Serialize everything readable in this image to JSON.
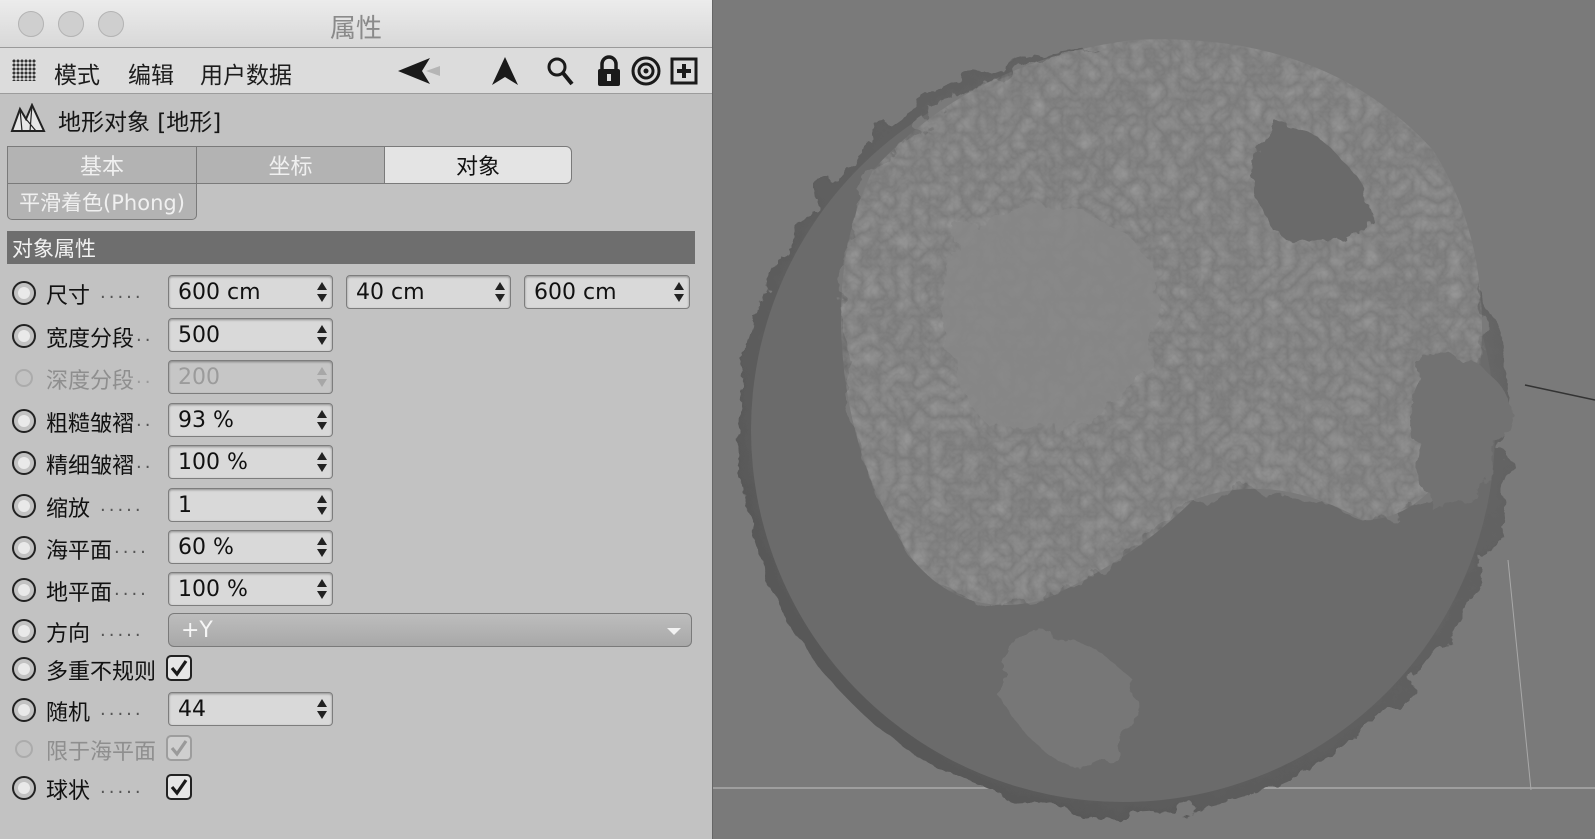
{
  "window": {
    "title": "属性"
  },
  "menu": {
    "items": [
      "模式",
      "编辑",
      "用户数据"
    ]
  },
  "toolbar": {
    "icons": [
      "back-arrow-icon",
      "up-arrow-icon",
      "search-icon",
      "lock-icon",
      "target-icon",
      "add-icon"
    ]
  },
  "object": {
    "title": "地形对象 [地形]",
    "icon": "terrain-icon"
  },
  "tabs": [
    {
      "label": "基本",
      "active": false
    },
    {
      "label": "坐标",
      "active": false
    },
    {
      "label": "对象",
      "active": true
    }
  ],
  "subtab": {
    "label": "平滑着色(Phong)"
  },
  "section": {
    "title": "对象属性"
  },
  "properties": {
    "size": {
      "label": "尺寸",
      "dots": ".....",
      "values": [
        "600 cm",
        "40 cm",
        "600 cm"
      ]
    },
    "width_seg": {
      "label": "宽度分段",
      "dots": "..",
      "value": "500"
    },
    "depth_seg": {
      "label": "深度分段",
      "dots": "..",
      "value": "200",
      "disabled": true
    },
    "rough": {
      "label": "粗糙皱褶",
      "dots": "..",
      "value": "93 %"
    },
    "fine": {
      "label": "精细皱褶",
      "dots": "..",
      "value": "100 %"
    },
    "scale": {
      "label": "缩放",
      "dots": ".....",
      "value": "1"
    },
    "sea": {
      "label": "海平面",
      "dots": "....",
      "value": "60 %"
    },
    "ground": {
      "label": "地平面",
      "dots": "....",
      "value": "100 %"
    },
    "direction": {
      "label": "方向",
      "dots": ".....",
      "value": "+Y"
    },
    "multifractal": {
      "label": "多重不规则",
      "checked": true
    },
    "random": {
      "label": "随机",
      "dots": ".....",
      "value": "44"
    },
    "limit_sea": {
      "label": "限于海平面",
      "checked": true,
      "disabled": true
    },
    "spherical": {
      "label": "球状",
      "dots": ".....",
      "checked": true
    }
  },
  "colors": {
    "panel": "#c2c2c2",
    "section": "#6e6e6e",
    "viewport": "#7a7a7a",
    "sphere": "#6e6e6e"
  }
}
